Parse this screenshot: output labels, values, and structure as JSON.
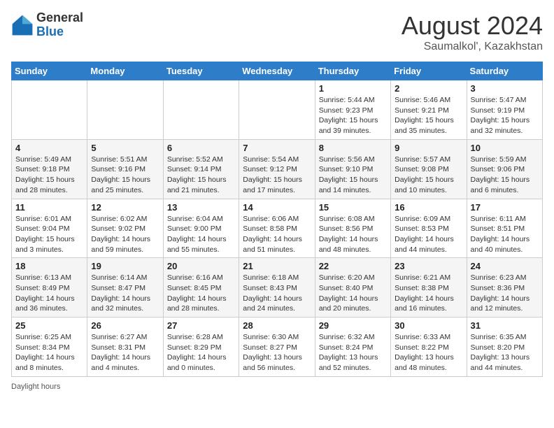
{
  "header": {
    "logo_general": "General",
    "logo_blue": "Blue",
    "month_title": "August 2024",
    "location": "Saumalkol', Kazakhstan"
  },
  "footer": {
    "daylight_note": "Daylight hours"
  },
  "weekdays": [
    "Sunday",
    "Monday",
    "Tuesday",
    "Wednesday",
    "Thursday",
    "Friday",
    "Saturday"
  ],
  "weeks": [
    [
      {
        "day": "",
        "info": ""
      },
      {
        "day": "",
        "info": ""
      },
      {
        "day": "",
        "info": ""
      },
      {
        "day": "",
        "info": ""
      },
      {
        "day": "1",
        "info": "Sunrise: 5:44 AM\nSunset: 9:23 PM\nDaylight: 15 hours and 39 minutes."
      },
      {
        "day": "2",
        "info": "Sunrise: 5:46 AM\nSunset: 9:21 PM\nDaylight: 15 hours and 35 minutes."
      },
      {
        "day": "3",
        "info": "Sunrise: 5:47 AM\nSunset: 9:19 PM\nDaylight: 15 hours and 32 minutes."
      }
    ],
    [
      {
        "day": "4",
        "info": "Sunrise: 5:49 AM\nSunset: 9:18 PM\nDaylight: 15 hours and 28 minutes."
      },
      {
        "day": "5",
        "info": "Sunrise: 5:51 AM\nSunset: 9:16 PM\nDaylight: 15 hours and 25 minutes."
      },
      {
        "day": "6",
        "info": "Sunrise: 5:52 AM\nSunset: 9:14 PM\nDaylight: 15 hours and 21 minutes."
      },
      {
        "day": "7",
        "info": "Sunrise: 5:54 AM\nSunset: 9:12 PM\nDaylight: 15 hours and 17 minutes."
      },
      {
        "day": "8",
        "info": "Sunrise: 5:56 AM\nSunset: 9:10 PM\nDaylight: 15 hours and 14 minutes."
      },
      {
        "day": "9",
        "info": "Sunrise: 5:57 AM\nSunset: 9:08 PM\nDaylight: 15 hours and 10 minutes."
      },
      {
        "day": "10",
        "info": "Sunrise: 5:59 AM\nSunset: 9:06 PM\nDaylight: 15 hours and 6 minutes."
      }
    ],
    [
      {
        "day": "11",
        "info": "Sunrise: 6:01 AM\nSunset: 9:04 PM\nDaylight: 15 hours and 3 minutes."
      },
      {
        "day": "12",
        "info": "Sunrise: 6:02 AM\nSunset: 9:02 PM\nDaylight: 14 hours and 59 minutes."
      },
      {
        "day": "13",
        "info": "Sunrise: 6:04 AM\nSunset: 9:00 PM\nDaylight: 14 hours and 55 minutes."
      },
      {
        "day": "14",
        "info": "Sunrise: 6:06 AM\nSunset: 8:58 PM\nDaylight: 14 hours and 51 minutes."
      },
      {
        "day": "15",
        "info": "Sunrise: 6:08 AM\nSunset: 8:56 PM\nDaylight: 14 hours and 48 minutes."
      },
      {
        "day": "16",
        "info": "Sunrise: 6:09 AM\nSunset: 8:53 PM\nDaylight: 14 hours and 44 minutes."
      },
      {
        "day": "17",
        "info": "Sunrise: 6:11 AM\nSunset: 8:51 PM\nDaylight: 14 hours and 40 minutes."
      }
    ],
    [
      {
        "day": "18",
        "info": "Sunrise: 6:13 AM\nSunset: 8:49 PM\nDaylight: 14 hours and 36 minutes."
      },
      {
        "day": "19",
        "info": "Sunrise: 6:14 AM\nSunset: 8:47 PM\nDaylight: 14 hours and 32 minutes."
      },
      {
        "day": "20",
        "info": "Sunrise: 6:16 AM\nSunset: 8:45 PM\nDaylight: 14 hours and 28 minutes."
      },
      {
        "day": "21",
        "info": "Sunrise: 6:18 AM\nSunset: 8:43 PM\nDaylight: 14 hours and 24 minutes."
      },
      {
        "day": "22",
        "info": "Sunrise: 6:20 AM\nSunset: 8:40 PM\nDaylight: 14 hours and 20 minutes."
      },
      {
        "day": "23",
        "info": "Sunrise: 6:21 AM\nSunset: 8:38 PM\nDaylight: 14 hours and 16 minutes."
      },
      {
        "day": "24",
        "info": "Sunrise: 6:23 AM\nSunset: 8:36 PM\nDaylight: 14 hours and 12 minutes."
      }
    ],
    [
      {
        "day": "25",
        "info": "Sunrise: 6:25 AM\nSunset: 8:34 PM\nDaylight: 14 hours and 8 minutes."
      },
      {
        "day": "26",
        "info": "Sunrise: 6:27 AM\nSunset: 8:31 PM\nDaylight: 14 hours and 4 minutes."
      },
      {
        "day": "27",
        "info": "Sunrise: 6:28 AM\nSunset: 8:29 PM\nDaylight: 14 hours and 0 minutes."
      },
      {
        "day": "28",
        "info": "Sunrise: 6:30 AM\nSunset: 8:27 PM\nDaylight: 13 hours and 56 minutes."
      },
      {
        "day": "29",
        "info": "Sunrise: 6:32 AM\nSunset: 8:24 PM\nDaylight: 13 hours and 52 minutes."
      },
      {
        "day": "30",
        "info": "Sunrise: 6:33 AM\nSunset: 8:22 PM\nDaylight: 13 hours and 48 minutes."
      },
      {
        "day": "31",
        "info": "Sunrise: 6:35 AM\nSunset: 8:20 PM\nDaylight: 13 hours and 44 minutes."
      }
    ]
  ]
}
